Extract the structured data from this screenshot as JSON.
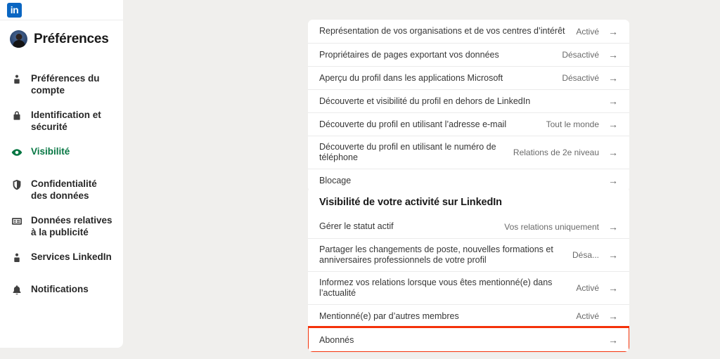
{
  "brand": {
    "logo_text": "in",
    "logo_color": "#0a66c2",
    "accent_green": "#057642",
    "highlight_red": "#f4320a"
  },
  "sidebar": {
    "title": "Préférences",
    "items": [
      {
        "label": "Préférences du compte",
        "icon": "person-icon",
        "active": false
      },
      {
        "label": "Identification et sécurité",
        "icon": "lock-icon",
        "active": false
      },
      {
        "label": "Visibilité",
        "icon": "eye-icon",
        "active": true
      },
      {
        "label": "Confidentialité des données",
        "icon": "shield-icon",
        "active": false
      },
      {
        "label": "Données relatives à la publicité",
        "icon": "ad-card-icon",
        "active": false
      },
      {
        "label": "Services LinkedIn",
        "icon": "person-icon",
        "active": false
      },
      {
        "label": "Notifications",
        "icon": "bell-icon",
        "active": false
      }
    ]
  },
  "main": {
    "cards": [
      {
        "title": "",
        "rows": [
          {
            "label": "Représentation de vos organisations et de vos centres d’intérêt",
            "value": "Activé",
            "arrow": "→"
          },
          {
            "label": "Propriétaires de pages exportant vos données",
            "value": "Désactivé",
            "arrow": "→"
          },
          {
            "label": "Aperçu du profil dans les applications Microsoft",
            "value": "Désactivé",
            "arrow": "→"
          },
          {
            "label": "Découverte et visibilité du profil en dehors de LinkedIn",
            "value": "",
            "arrow": "→"
          },
          {
            "label": "Découverte du profil en utilisant l’adresse e-mail",
            "value": "Tout le monde",
            "arrow": "→"
          },
          {
            "label": "Découverte du profil en utilisant le numéro de téléphone",
            "value": "Relations de 2e niveau",
            "arrow": "→"
          },
          {
            "label": "Blocage",
            "value": "",
            "arrow": "→"
          }
        ]
      },
      {
        "title": "Visibilité de votre activité sur LinkedIn",
        "rows": [
          {
            "label": "Gérer le statut actif",
            "value": "Vos relations uniquement",
            "arrow": "→"
          },
          {
            "label": "Partager les changements de poste, nouvelles formations et anniversaires professionnels de votre profil",
            "value": "Désa...",
            "arrow": "→"
          },
          {
            "label": "Informez vos relations lorsque vous êtes mentionné(e) dans l’actualité",
            "value": "Activé",
            "arrow": "→"
          },
          {
            "label": "Mentionné(e) par d’autres membres",
            "value": "Activé",
            "arrow": "→"
          },
          {
            "label": "Abonnés",
            "value": "",
            "arrow": "→"
          }
        ]
      }
    ]
  }
}
